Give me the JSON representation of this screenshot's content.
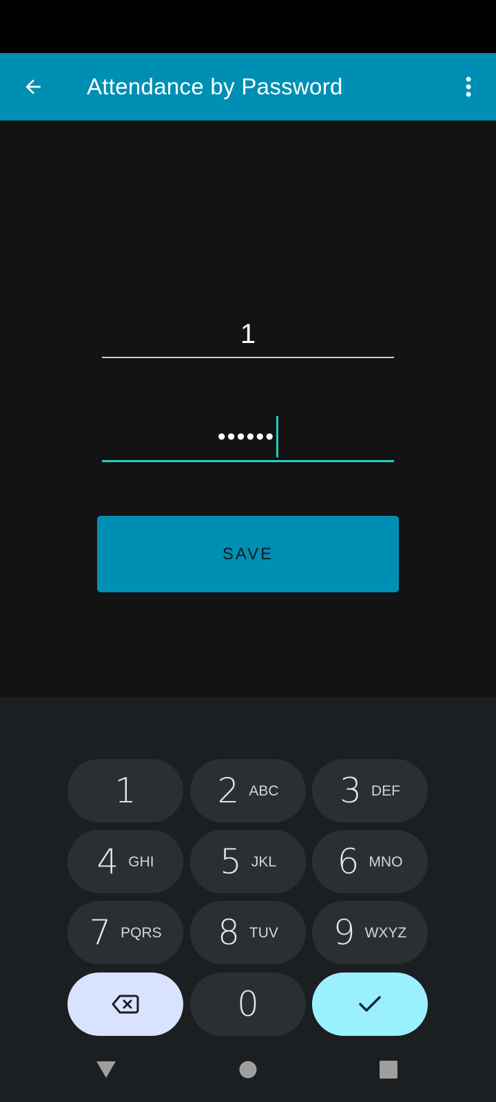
{
  "colors": {
    "app_bar": "#008fb4",
    "save_button": "#008fb4",
    "accent": "#1fd1c2",
    "background": "#131313",
    "keyboard_bg": "#1b1f21"
  },
  "app_bar": {
    "title": "Attendance by Password",
    "back_icon": "arrow-back-icon",
    "menu_icon": "more-vert-icon"
  },
  "form": {
    "username_value": "1",
    "password_value": "••••••",
    "save_label": "SAVE"
  },
  "keypad": {
    "keys": [
      {
        "digit": "1",
        "letters": ""
      },
      {
        "digit": "2",
        "letters": "ABC"
      },
      {
        "digit": "3",
        "letters": "DEF"
      },
      {
        "digit": "4",
        "letters": "GHI"
      },
      {
        "digit": "5",
        "letters": "JKL"
      },
      {
        "digit": "6",
        "letters": "MNO"
      },
      {
        "digit": "7",
        "letters": "PQRS"
      },
      {
        "digit": "8",
        "letters": "TUV"
      },
      {
        "digit": "9",
        "letters": "WXYZ"
      }
    ],
    "zero": "0",
    "backspace_icon": "backspace-icon",
    "done_icon": "check-icon"
  },
  "nav": {
    "back_icon": "nav-back-icon",
    "home_icon": "nav-home-icon",
    "recents_icon": "nav-recents-icon"
  }
}
